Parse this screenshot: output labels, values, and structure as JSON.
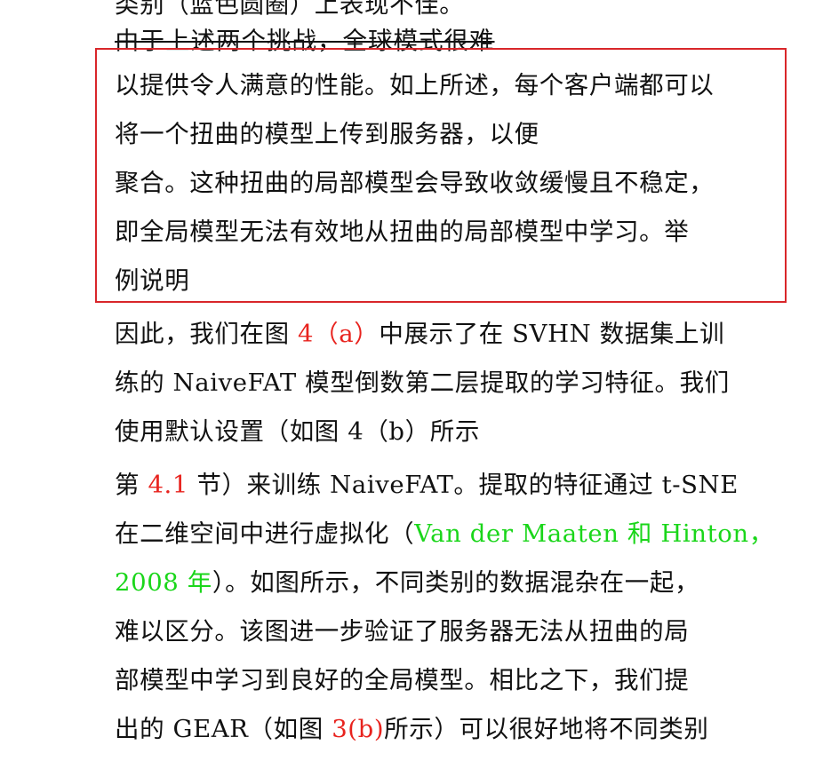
{
  "lines": [
    {
      "text": "类别（蓝色圆圈）上表现不佳。"
    },
    {
      "text": "  由于上述两个挑战，全球模式很难"
    },
    {
      "text": "以提供令人满意的性能。如上所述，每个客户端都可以"
    },
    {
      "text": "将一个扭曲的模型上传到服务器，以便"
    },
    {
      "text": "聚合。这种扭曲的局部模型会导致收敛缓慢且不稳定，"
    },
    {
      "text": "即全局模型无法有效地从扭曲的局部模型中学习。举"
    },
    {
      "text": "例说明"
    },
    {
      "parts": [
        "因此，我们在图 ",
        "4（a）",
        "中展示了在 SVHN 数据集上训"
      ]
    },
    {
      "text": "练的 NaiveFAT 模型倒数第二层提取的学习特征。我们"
    },
    {
      "text": "使用默认设置（如图 4（b）所示"
    },
    {
      "parts": [
        "第 ",
        "4.1",
        " 节）来训练 NaiveFAT。提取的特征通过 t-SNE"
      ]
    },
    {
      "parts": [
        "在二维空间中进行虚拟化（",
        "Van der Maaten 和 Hinton，"
      ]
    },
    {
      "parts": [
        "2008 年",
        "）。如图所示，不同类别的数据混杂在一起，"
      ]
    },
    {
      "text": "难以区分。该图进一步验证了服务器无法从扭曲的局"
    },
    {
      "text": "部模型中学习到良好的全局模型。相比之下，我们提"
    },
    {
      "parts": [
        "出的 GEAR（如图 ",
        "3(b)",
        "所示）可以很好地将不同类别"
      ]
    }
  ],
  "colors": {
    "reference_link": "#e8231e",
    "citation_link": "#1ad61a",
    "highlight_box": "#d9262a"
  }
}
